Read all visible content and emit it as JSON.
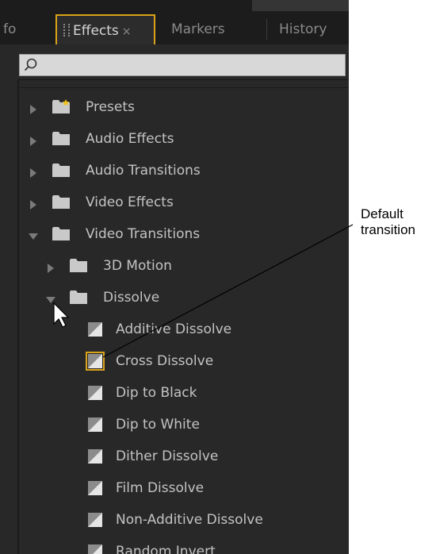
{
  "tabs": [
    {
      "label": "fo"
    },
    {
      "label": "Effects",
      "close": "×"
    },
    {
      "label": "Markers"
    },
    {
      "label": "History"
    }
  ],
  "search": {
    "value": "",
    "placeholder": ""
  },
  "tree": [
    {
      "label": "Presets",
      "icon": "preset-folder-icon",
      "expanded": false
    },
    {
      "label": "Audio Effects",
      "icon": "folder-icon",
      "expanded": false
    },
    {
      "label": "Audio Transitions",
      "icon": "folder-icon",
      "expanded": false
    },
    {
      "label": "Video Effects",
      "icon": "folder-icon",
      "expanded": false
    },
    {
      "label": "Video Transitions",
      "icon": "folder-icon",
      "expanded": true
    },
    {
      "label": "3D Motion",
      "icon": "folder-icon",
      "expanded": false
    },
    {
      "label": "Dissolve",
      "icon": "folder-icon",
      "expanded": true
    },
    {
      "label": "Additive Dissolve",
      "icon": "transition-icon"
    },
    {
      "label": "Cross Dissolve",
      "icon": "transition-icon",
      "selected": true
    },
    {
      "label": "Dip to Black",
      "icon": "transition-icon"
    },
    {
      "label": "Dip to White",
      "icon": "transition-icon"
    },
    {
      "label": "Dither Dissolve",
      "icon": "transition-icon"
    },
    {
      "label": "Film Dissolve",
      "icon": "transition-icon"
    },
    {
      "label": "Non-Additive Dissolve",
      "icon": "transition-icon"
    },
    {
      "label": "Random Invert",
      "icon": "transition-icon"
    }
  ],
  "callout": {
    "line1": "Default",
    "line2": "transition"
  },
  "colors": {
    "accent": "#d9a21a",
    "panel": "#282828",
    "text": "#c3c3c3"
  }
}
